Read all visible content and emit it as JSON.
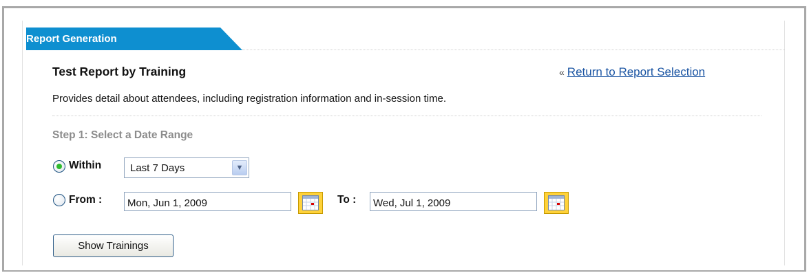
{
  "tab": {
    "title": "Report Generation"
  },
  "report": {
    "title": "Test Report by Training",
    "description": "Provides detail about attendees, including registration information and in-session time."
  },
  "nav": {
    "return_prefix": "«",
    "return_link": "Return to Report Selection"
  },
  "step1": {
    "heading": "Step 1: Select a Date Range",
    "within_label": "Within",
    "within_selected": "Last 7 Days",
    "from_label": "From :",
    "from_value": "Mon, Jun 1, 2009",
    "to_label": "To :",
    "to_value": "Wed, Jul 1, 2009",
    "selected_option": "Within"
  },
  "actions": {
    "show_trainings": "Show Trainings"
  },
  "colors": {
    "tab_blue": "#0e8fd0",
    "link_blue": "#1b55a3",
    "step_gray": "#8c8c8c",
    "calendar_yellow": "#ffd23a",
    "radio_green": "#2fbb2f"
  },
  "icons": {
    "calendar": "calendar-icon",
    "dropdown": "chevron-down-icon",
    "radio": "radio-button"
  }
}
